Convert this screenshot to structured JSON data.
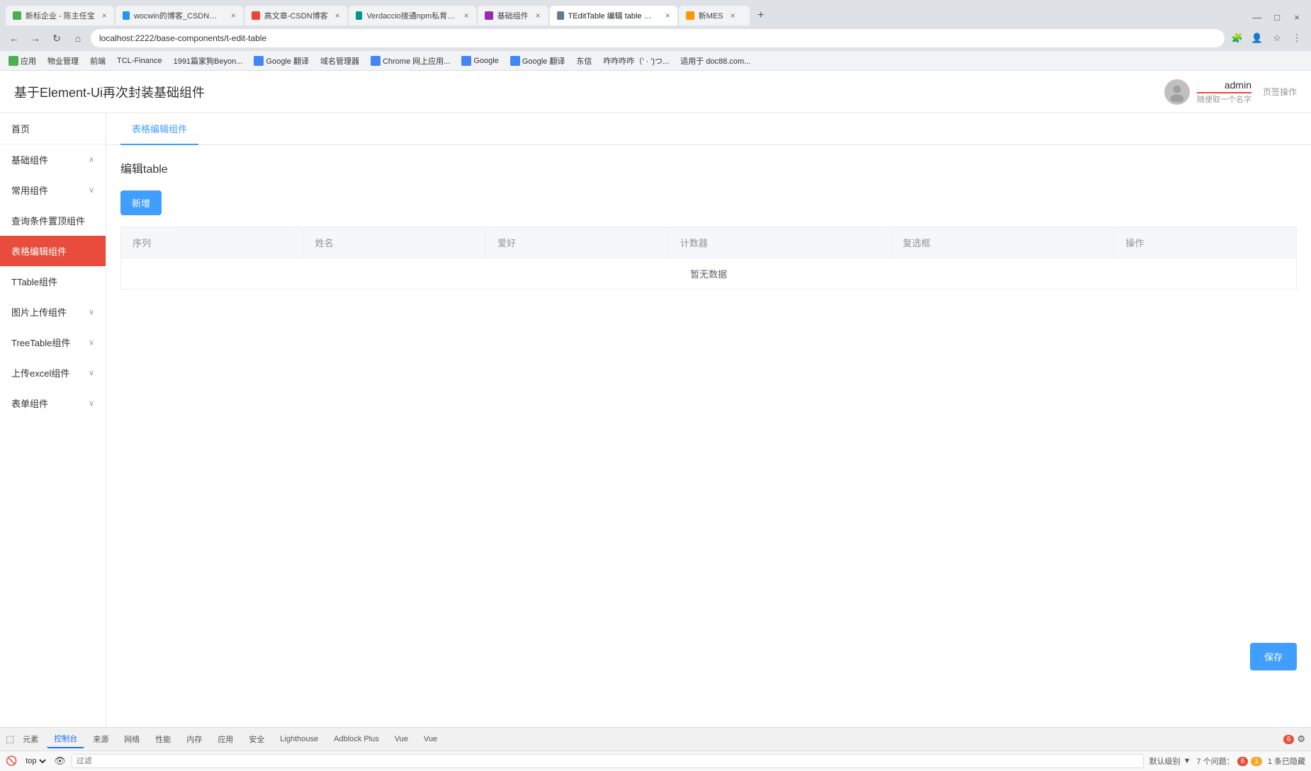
{
  "browser": {
    "tabs": [
      {
        "label": "新标企业 - 陈主任宝",
        "active": false
      },
      {
        "label": "wocwin的博客_CSDN博客-基...",
        "active": false
      },
      {
        "label": "高文章-CSDN博客",
        "active": false
      },
      {
        "label": "Verdaccio接通npm私育经务析...",
        "active": false
      },
      {
        "label": "基础组件",
        "active": false
      },
      {
        "label": "TEditTable 编辑 table 组件 | w...",
        "active": true
      },
      {
        "label": "新MES",
        "active": false
      }
    ],
    "address": "localhost:2222/base-components/t-edit-table",
    "bookmarks": [
      {
        "label": "应用"
      },
      {
        "label": "物业管理"
      },
      {
        "label": "前端"
      },
      {
        "label": "TCL-Finance"
      },
      {
        "label": "1991篇家狗Beyon..."
      },
      {
        "label": "Google 翻译"
      },
      {
        "label": "域名管理器"
      },
      {
        "label": "Chrome 网上应用..."
      },
      {
        "label": "Google"
      },
      {
        "label": "Google 翻译"
      },
      {
        "label": "东信"
      },
      {
        "label": "咋咋咋咋（' · ')つ..."
      },
      {
        "label": "适用于 doc88.com..."
      }
    ]
  },
  "app": {
    "title": "基于Element-Ui再次封装基础组件",
    "user": {
      "name": "admin",
      "subtitle": "随便取一个名字"
    },
    "page_ops": "页签操作"
  },
  "sidebar": {
    "items": [
      {
        "label": "首页",
        "active": false,
        "has_chevron": false
      },
      {
        "label": "基础组件",
        "active": false,
        "has_chevron": true
      },
      {
        "label": "常用组件",
        "active": false,
        "has_chevron": true
      },
      {
        "label": "查询条件置顶组件",
        "active": false,
        "has_chevron": false
      },
      {
        "label": "表格编辑组件",
        "active": true,
        "has_chevron": false
      },
      {
        "label": "TTable组件",
        "active": false,
        "has_chevron": false
      },
      {
        "label": "图片上传组件",
        "active": false,
        "has_chevron": true
      },
      {
        "label": "TreeTable组件",
        "active": false,
        "has_chevron": true
      },
      {
        "label": "上传excel组件",
        "active": false,
        "has_chevron": true
      },
      {
        "label": "表单组件",
        "active": false,
        "has_chevron": true
      }
    ]
  },
  "content": {
    "tab": "表格编辑组件",
    "section_title": "编辑table",
    "add_button": "新增",
    "save_button": "保存",
    "table": {
      "columns": [
        "序列",
        "姓名",
        "爱好",
        "计数器",
        "复选框",
        "操作"
      ],
      "no_data": "暂无数据"
    }
  },
  "devtools": {
    "tabs": [
      "元素",
      "控制台",
      "来源",
      "网络",
      "性能",
      "内存",
      "应用",
      "安全",
      "Lighthouse",
      "Adblock Plus",
      "Vue",
      "Vue"
    ],
    "active_tab": "控制台",
    "top_label": "top",
    "filter_placeholder": "过滤",
    "default_level": "默认级别",
    "issues": "7 个问题：",
    "errors": "6",
    "warnings": "1",
    "hidden": "1 条已隐藏",
    "settings_icon": "⚙",
    "error_count": "6"
  }
}
